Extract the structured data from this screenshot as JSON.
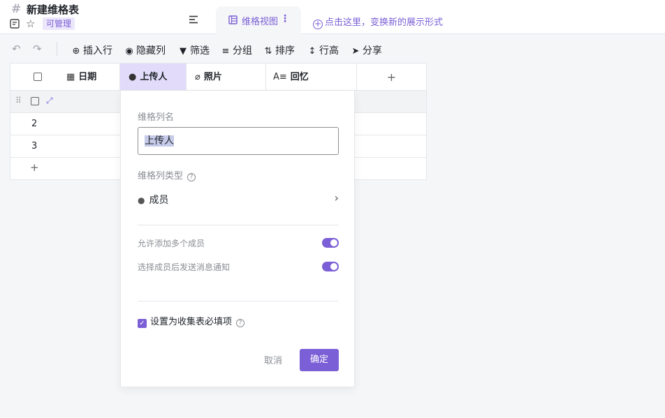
{
  "header": {
    "title": "新建维格表",
    "badge": "可管理",
    "view_tab_label": "维格视图",
    "add_view_label": "点击这里，变换新的展示形式"
  },
  "toolbar": {
    "insert_row": "插入行",
    "hide_columns": "隐藏列",
    "filter": "筛选",
    "group": "分组",
    "sort": "排序",
    "row_height": "行高",
    "share": "分享"
  },
  "grid": {
    "columns": [
      "日期",
      "上传人",
      "照片",
      "回忆"
    ],
    "add_column": "+",
    "rows": [
      "2",
      "3"
    ],
    "add_row": "+"
  },
  "popup": {
    "name_label": "维格列名",
    "name_value": "上传人",
    "type_label": "维格列类型",
    "type_value": "成员",
    "option_multiple": "允许添加多个成员",
    "option_multiple_on": true,
    "option_notify": "选择成员后发送消息通知",
    "option_notify_on": true,
    "required_label": "设置为收集表必填项",
    "required_checked": true,
    "cancel": "取消",
    "confirm": "确定"
  },
  "colors": {
    "accent": "#7b5fd6",
    "accent_light": "#e2dcfa"
  }
}
